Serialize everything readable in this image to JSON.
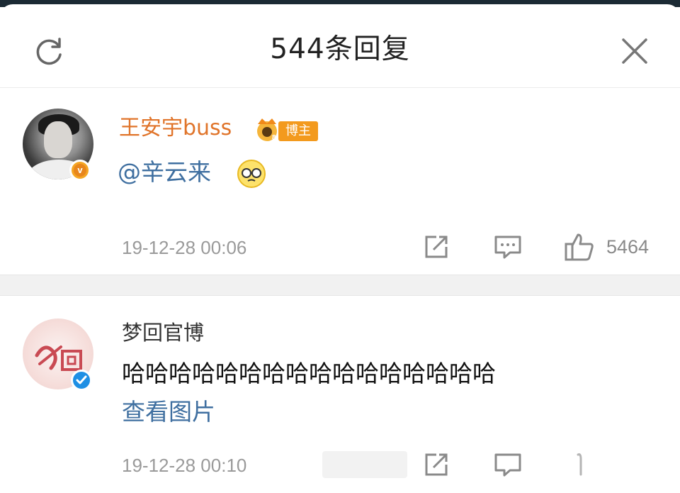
{
  "header": {
    "title": "544条回复"
  },
  "comments": [
    {
      "username": "王安宇buss",
      "badge": "博主",
      "text": "@辛云来",
      "timestamp": "19-12-28 00:06",
      "likes": "5464"
    },
    {
      "username": "梦回官博",
      "text": "哈哈哈哈哈哈哈哈哈哈哈哈哈哈哈哈",
      "link": "查看图片",
      "timestamp": "19-12-28 00:10"
    }
  ],
  "icons": {
    "refresh": "refresh-icon",
    "close": "close-icon",
    "share": "share-icon",
    "reply": "comment-icon",
    "like": "thumbs-up-icon"
  },
  "colors": {
    "username_orange": "#e0742a",
    "mention_blue": "#3f6fa0",
    "badge_orange": "#f39a1d",
    "verified_blue": "#1f8fe4",
    "meta_gray": "#9a9a9a"
  }
}
